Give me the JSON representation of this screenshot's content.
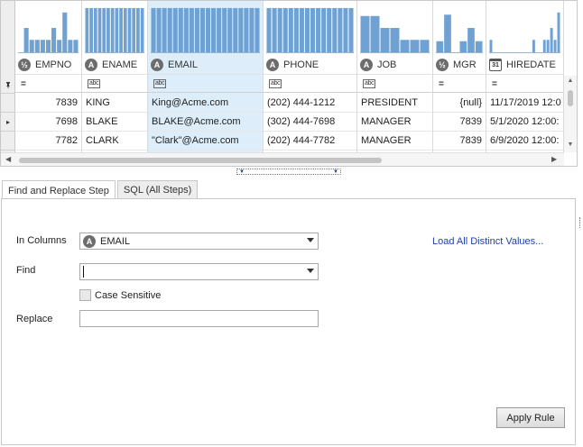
{
  "grid": {
    "columns": [
      {
        "name": "EMPNO",
        "type_icon": "1-2",
        "filter_symbol": "=",
        "values": [
          "7839",
          "7698",
          "7782"
        ],
        "align": "right",
        "histogram": [
          0,
          0.55,
          0.28,
          0.28,
          0.28,
          0.28,
          0.55,
          0.28,
          0.9,
          0.28,
          0.28
        ],
        "selected": false
      },
      {
        "name": "ENAME",
        "type_icon": "A",
        "filter_symbol": "abc",
        "values": [
          "KING",
          "BLAKE",
          "CLARK"
        ],
        "align": "left",
        "histogram": [
          1,
          1,
          1,
          1,
          1,
          1,
          1,
          1,
          1,
          1,
          1,
          1,
          1,
          1
        ],
        "selected": false
      },
      {
        "name": "EMAIL",
        "type_icon": "A",
        "filter_symbol": "abc",
        "values": [
          "King@Acme.com",
          "BLAKE@Acme.com",
          "\"Clark\"@Acme.com"
        ],
        "align": "left",
        "histogram": [
          1,
          1,
          1,
          1,
          1,
          1,
          1,
          1,
          1,
          1,
          1,
          1,
          1,
          1,
          1,
          1,
          1,
          1,
          1,
          1
        ],
        "selected": true
      },
      {
        "name": "PHONE",
        "type_icon": "A",
        "filter_symbol": "abc",
        "values": [
          "(202) 444-1212",
          "(302) 444-7698",
          "(202) 444-7782"
        ],
        "align": "left",
        "histogram": [
          1,
          1,
          1,
          1,
          1,
          1,
          1,
          1,
          1,
          1,
          1,
          1,
          1,
          1,
          1,
          1
        ],
        "selected": false
      },
      {
        "name": "JOB",
        "type_icon": "A",
        "filter_symbol": "abc",
        "values": [
          "PRESIDENT",
          "MANAGER",
          "MANAGER"
        ],
        "align": "left",
        "histogram": [
          0.82,
          0.82,
          0.55,
          0.55,
          0.28,
          0.28,
          0.28
        ],
        "selected": false
      },
      {
        "name": "MGR",
        "type_icon": "1-2",
        "filter_symbol": "=",
        "values": [
          "{null}",
          "7839",
          "7839"
        ],
        "align": "right",
        "histogram": [
          0.25,
          0.85,
          0,
          0.25,
          0.55,
          0.25
        ],
        "selected": false
      },
      {
        "name": "HIREDATE",
        "type_icon": "31",
        "filter_symbol": "=",
        "values": [
          "11/17/2019 12:0",
          "5/1/2020 12:00:",
          "6/9/2020 12:00:"
        ],
        "align": "left",
        "histogram": [
          0.28,
          0,
          0,
          0,
          0,
          0,
          0,
          0,
          0,
          0,
          0,
          0,
          0.28,
          0,
          0,
          0.28,
          0.28,
          0.55,
          0.28,
          0.9
        ],
        "selected": false
      }
    ],
    "row_indicator": "▸",
    "row_header_corner_icon": "pin-icon",
    "histogram_color": "#6fa1d2"
  },
  "tabs": [
    {
      "label": "Find and Replace Step",
      "active": true
    },
    {
      "label": "SQL (All Steps)",
      "active": false
    }
  ],
  "form": {
    "in_columns_label": "In Columns",
    "in_columns_value": "EMAIL",
    "in_columns_icon": "A",
    "find_label": "Find",
    "find_value": "",
    "case_sensitive_label": "Case Sensitive",
    "case_sensitive_checked": false,
    "replace_label": "Replace",
    "replace_value": "",
    "load_link": "Load All Distinct Values...",
    "apply_button": "Apply Rule"
  }
}
